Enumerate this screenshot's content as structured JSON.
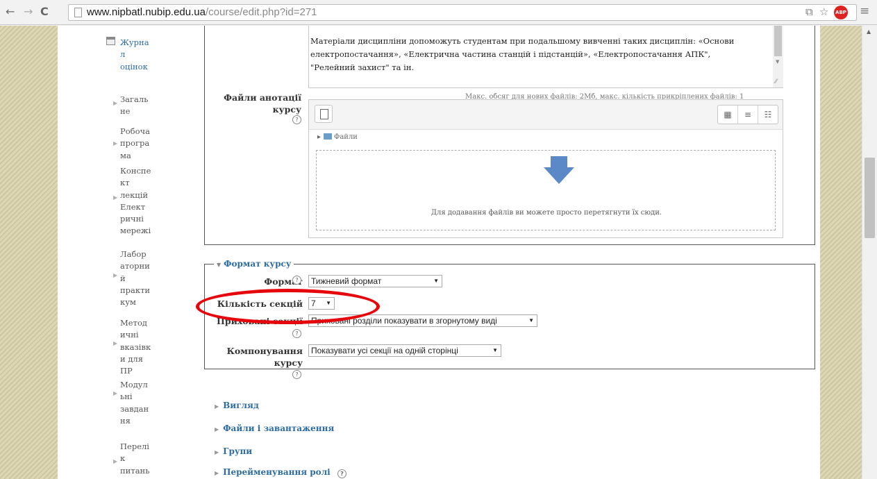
{
  "browser": {
    "url_host": "www.nipbatl.nubip.edu.ua",
    "url_path": "/course/edit.php?id=271",
    "abp_label": "ABP"
  },
  "sidebar": {
    "items": [
      {
        "label": "Журнал оцінок",
        "lines": [
          "Журна",
          "л",
          "оцінок"
        ],
        "link": true
      },
      {
        "label": "Загальне",
        "lines": [
          "Загаль",
          "не"
        ]
      },
      {
        "label": "Робоча програма",
        "lines": [
          "Робоча",
          "програ",
          "ма"
        ]
      },
      {
        "label": "Конспект лекцій Електричні мережі",
        "lines": [
          "Конспе",
          "кт",
          "лекцій",
          "Елект",
          "ричні",
          "мережі"
        ]
      },
      {
        "label": "Лабораторний практикум",
        "lines": [
          "Лабор",
          "аторни",
          "й",
          "практи",
          "кум"
        ]
      },
      {
        "label": "Методичні вказівки для ПР",
        "lines": [
          "Метод",
          "ичні",
          "вказівк",
          "и для",
          "ПР"
        ]
      },
      {
        "label": "Модульні завдання",
        "lines": [
          "Модул",
          "ьні",
          "завдан",
          "ня"
        ]
      },
      {
        "label": "Перелік питань",
        "lines": [
          "Перелі",
          "к",
          "питань"
        ]
      }
    ]
  },
  "editor": {
    "line1": "Матеріали дисципліни допоможуть студентам при подальшому вивченні таких дисциплін: «Основи",
    "line2": "електропостачання», «Електрична частина станцій і підстанцій», «Електропостачання АПК\",",
    "line3": "\"Релейний захист\" та ін."
  },
  "annotation_files": {
    "label_line1": "Файли анотації",
    "label_line2": "курсу",
    "limits": "Макс. обсяг для нових файлів: 2Мб, макс. кількість прикріплених файлів: 1",
    "folder_label": "Файли",
    "drop_text": "Для додавання файлів ви можете просто перетягнути їх сюди."
  },
  "course_format": {
    "legend": "Формат курсу",
    "format_label": "Формат",
    "format_value": "Тижневий формат",
    "sections_label": "Кількість секцій",
    "sections_value": "7",
    "hidden_label": "Приховані секції",
    "hidden_value": "Приховані розділи показувати в згорнутому виді",
    "layout_label_line1": "Компонування",
    "layout_label_line2": "курсу",
    "layout_value": "Показувати усі секції на одній сторінці"
  },
  "collapsed_sections": [
    "Вигляд",
    "Файли і завантаження",
    "Групи",
    "Перейменування ролі"
  ],
  "accent_colors": {
    "link": "#2d6ca2",
    "highlight": "#e6070d"
  }
}
